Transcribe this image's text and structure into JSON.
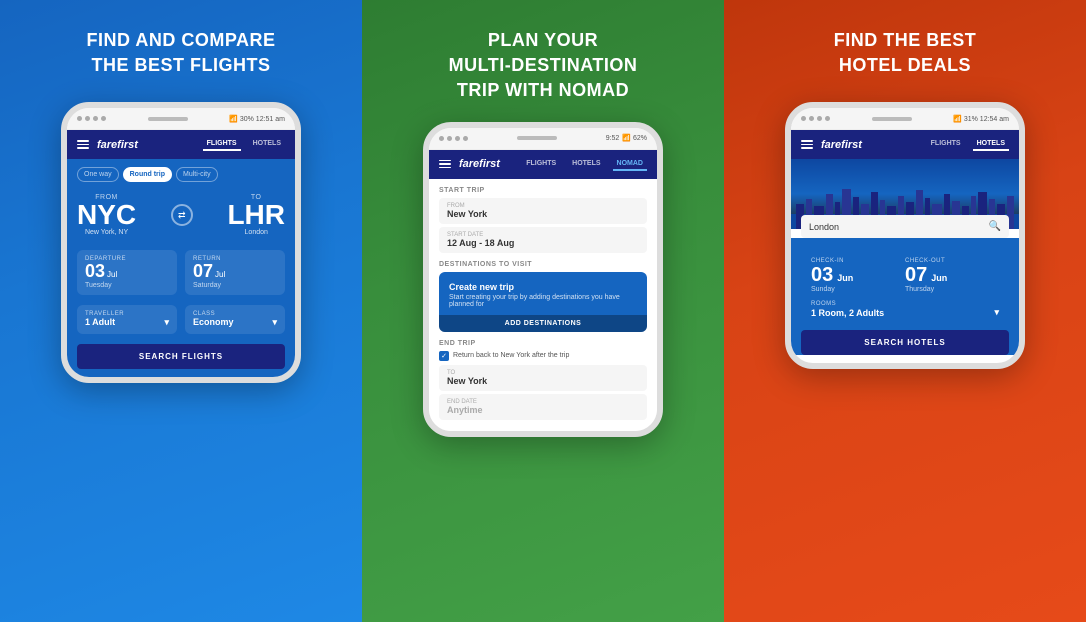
{
  "panels": [
    {
      "id": "flights",
      "bg": "blue",
      "title": "FIND AND COMPARE\nTHE BEST FLIGHTS",
      "app": {
        "status": "📶 30% 12:51 am",
        "nav": {
          "logo": "farefirst",
          "tabs": [
            {
              "label": "FLIGHTS",
              "active": true
            },
            {
              "label": "HOTELS",
              "active": false
            }
          ]
        },
        "tripTypes": [
          "One way",
          "Round trip",
          "Multi-city"
        ],
        "activeTripType": "Round trip",
        "from": {
          "label": "FROM",
          "code": "NYC",
          "city": "New York, NY"
        },
        "to": {
          "label": "TO",
          "code": "LHR",
          "city": "London"
        },
        "departure": {
          "label": "DEPARTURE",
          "day": "03",
          "suffix": "Jul",
          "weekday": "Tuesday"
        },
        "return": {
          "label": "RETURN",
          "day": "07",
          "suffix": "Jul",
          "weekday": "Saturday"
        },
        "traveller": {
          "label": "TRAVELLER",
          "value": "1 Adult"
        },
        "class": {
          "label": "CLASS",
          "value": "Economy"
        },
        "searchBtn": "SEARCH FLIGHTS"
      }
    },
    {
      "id": "nomad",
      "bg": "green",
      "title": "PLAN YOUR\nMULTI-DESTINATION\nTRIP WITH NOMAD",
      "app": {
        "status": "9:52",
        "status2": "📶 62%",
        "nav": {
          "logo": "farefirst",
          "tabs": [
            {
              "label": "FLIGHTS",
              "active": false
            },
            {
              "label": "HOTELS",
              "active": false
            },
            {
              "label": "NOMAD",
              "active": true,
              "highlight": true
            }
          ]
        },
        "startTrip": {
          "label": "START TRIP",
          "from": {
            "label": "From",
            "value": "New York"
          },
          "startDate": {
            "label": "Start date",
            "value": "12 Aug - 18 Aug"
          }
        },
        "destinations": {
          "label": "DESTINATIONS TO VISIT",
          "card": {
            "title": "Create new trip",
            "desc": "Start creating your trip by adding destinations you have planned for",
            "btnLabel": "ADD DESTINATIONS"
          }
        },
        "endTrip": {
          "label": "END TRIP",
          "checkboxText": "Return back to New York after the trip",
          "to": {
            "label": "To",
            "value": "New York"
          },
          "endDate": {
            "label": "End date",
            "value": "Anytime"
          }
        }
      }
    },
    {
      "id": "hotels",
      "bg": "orange",
      "title": "FIND THE BEST\nHOTEL DEALS",
      "app": {
        "status": "📶 31% 12:54 am",
        "nav": {
          "logo": "farefirst",
          "tabs": [
            {
              "label": "FLIGHTS",
              "active": false
            },
            {
              "label": "HOTELS",
              "active": true
            }
          ]
        },
        "searchCity": "London",
        "checkin": {
          "label": "CHECK-IN",
          "day": "03",
          "month": "Jun",
          "weekday": "Sunday"
        },
        "checkout": {
          "label": "CHECK-OUT",
          "day": "07",
          "month": "Jun",
          "weekday": "Thursday"
        },
        "rooms": {
          "label": "ROOMS",
          "value": "1 Room, 2 Adults"
        },
        "searchBtn": "SEARCH HOTELS"
      }
    }
  ]
}
